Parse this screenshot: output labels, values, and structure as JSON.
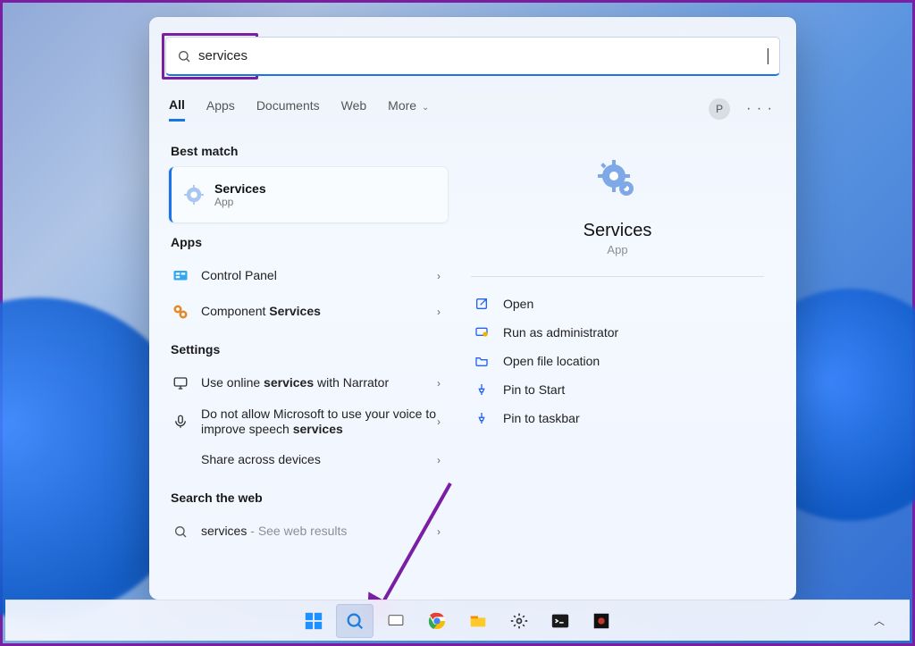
{
  "annotation": {
    "color": "#7b1fa2"
  },
  "search": {
    "query": "services"
  },
  "tabs": {
    "all": "All",
    "apps": "Apps",
    "documents": "Documents",
    "web": "Web",
    "more": "More"
  },
  "profile": {
    "initial": "P"
  },
  "sections": {
    "best_match": "Best match",
    "apps": "Apps",
    "settings": "Settings",
    "web": "Search the web"
  },
  "best": {
    "title": "Services",
    "subtitle": "App"
  },
  "apps_results": {
    "0": {
      "label": "Control Panel"
    },
    "1": {
      "prefix": "Component ",
      "bold": "Services"
    }
  },
  "settings_results": {
    "0": {
      "pre": "Use online ",
      "bold": "services",
      "post": " with Narrator"
    },
    "1": {
      "pre": "Do not allow Microsoft to use your voice to improve speech ",
      "bold": "services"
    },
    "2": {
      "label": "Share across devices"
    }
  },
  "web_result": {
    "term": "services",
    "hint": "See web results"
  },
  "detail": {
    "title": "Services",
    "subtitle": "App"
  },
  "actions": {
    "open": "Open",
    "admin": "Run as administrator",
    "location": "Open file location",
    "pin_start": "Pin to Start",
    "pin_taskbar": "Pin to taskbar"
  }
}
